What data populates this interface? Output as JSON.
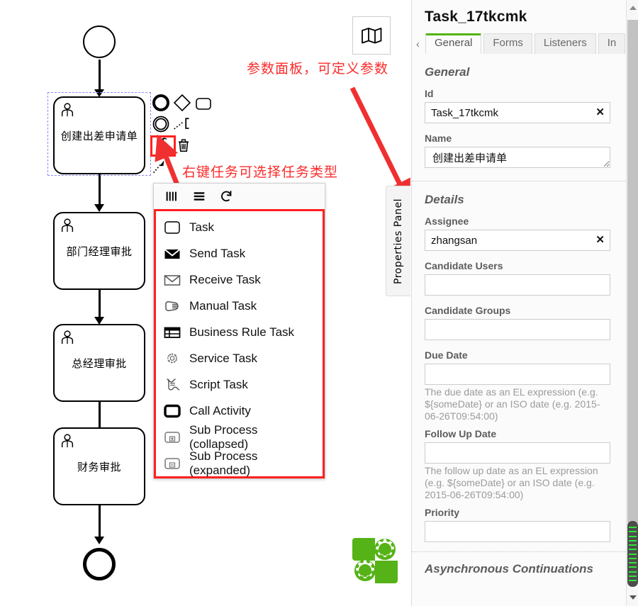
{
  "canvas": {
    "diagram": {
      "start_event": {
        "name": "start-event"
      },
      "tasks": [
        {
          "label": "创建出差申请单",
          "type": "user-task",
          "selected": true
        },
        {
          "label": "部门经理审批",
          "type": "user-task",
          "selected": false
        },
        {
          "label": "总经理审批",
          "type": "user-task",
          "selected": false
        },
        {
          "label": "财务审批",
          "type": "user-task",
          "selected": false
        }
      ],
      "end_event": {
        "name": "end-event"
      }
    },
    "context_pad_icons": [
      "circle-event-icon",
      "diamond-gateway-icon",
      "rounded-task-icon",
      "intermediate-event-icon",
      "connection-icon",
      "wrench-icon",
      "trash-icon",
      "append-arrow-icon"
    ],
    "map_button_icon": "map-icon",
    "brand_logo": "camunda-gears-logo",
    "brand_logo_color": "#55b317"
  },
  "annotations": {
    "accent_color": "#fc2b2b",
    "items": [
      {
        "text": "参数面板，可定义参数"
      },
      {
        "text": "右键任务可选择任务类型"
      }
    ]
  },
  "replace_menu": {
    "border_color": "#ff2020",
    "header_icons": [
      "multi-instance-parallel-icon",
      "multi-instance-sequential-icon",
      "loop-marker-icon"
    ],
    "items": [
      {
        "icon": "task-icon",
        "label": "Task"
      },
      {
        "icon": "send-task-icon",
        "label": "Send Task"
      },
      {
        "icon": "receive-task-icon",
        "label": "Receive Task"
      },
      {
        "icon": "manual-task-icon",
        "label": "Manual Task"
      },
      {
        "icon": "business-rule-task-icon",
        "label": "Business Rule Task"
      },
      {
        "icon": "service-task-icon",
        "label": "Service Task"
      },
      {
        "icon": "script-task-icon",
        "label": "Script Task"
      },
      {
        "icon": "call-activity-icon",
        "label": "Call Activity"
      },
      {
        "icon": "sub-process-collapsed-icon",
        "label": "Sub Process (collapsed)"
      },
      {
        "icon": "sub-process-expanded-icon",
        "label": "Sub Process (expanded)"
      }
    ]
  },
  "properties_panel_tab": {
    "label": "Properties Panel"
  },
  "properties_panel": {
    "title": "Task_17tkcmk",
    "tabs": {
      "prev_arrow": "‹",
      "next_arrow": "›",
      "items": [
        {
          "label": "General",
          "active": true
        },
        {
          "label": "Forms",
          "active": false
        },
        {
          "label": "Listeners",
          "active": false
        },
        {
          "label": "In",
          "active": false
        }
      ],
      "active_color": "#52b415"
    },
    "groups": [
      {
        "title": "General",
        "fields": [
          {
            "label": "Id",
            "value": "Task_17tkcmk",
            "clear": "✕",
            "kind": "input"
          },
          {
            "label": "Name",
            "value": "创建出差申请单",
            "kind": "textarea"
          }
        ]
      },
      {
        "title": "Details",
        "fields": [
          {
            "label": "Assignee",
            "value": "zhangsan",
            "clear": "✕",
            "kind": "input"
          },
          {
            "label": "Candidate Users",
            "value": "",
            "kind": "input"
          },
          {
            "label": "Candidate Groups",
            "value": "",
            "kind": "input"
          },
          {
            "label": "Due Date",
            "value": "",
            "kind": "input",
            "hint": "The due date as an EL expression (e.g. ${someDate} or an ISO date (e.g. 2015-06-26T09:54:00)"
          },
          {
            "label": "Follow Up Date",
            "value": "",
            "kind": "input",
            "hint": "The follow up date as an EL expression (e.g. ${someDate} or an ISO date (e.g. 2015-06-26T09:54:00)"
          },
          {
            "label": "Priority",
            "value": "",
            "kind": "input"
          }
        ]
      },
      {
        "title": "Asynchronous Continuations",
        "fields": []
      }
    ],
    "scrollbar": {
      "up_arrow": "scroll-up-arrow-icon",
      "down_arrow": "scroll-down-arrow-icon"
    }
  }
}
